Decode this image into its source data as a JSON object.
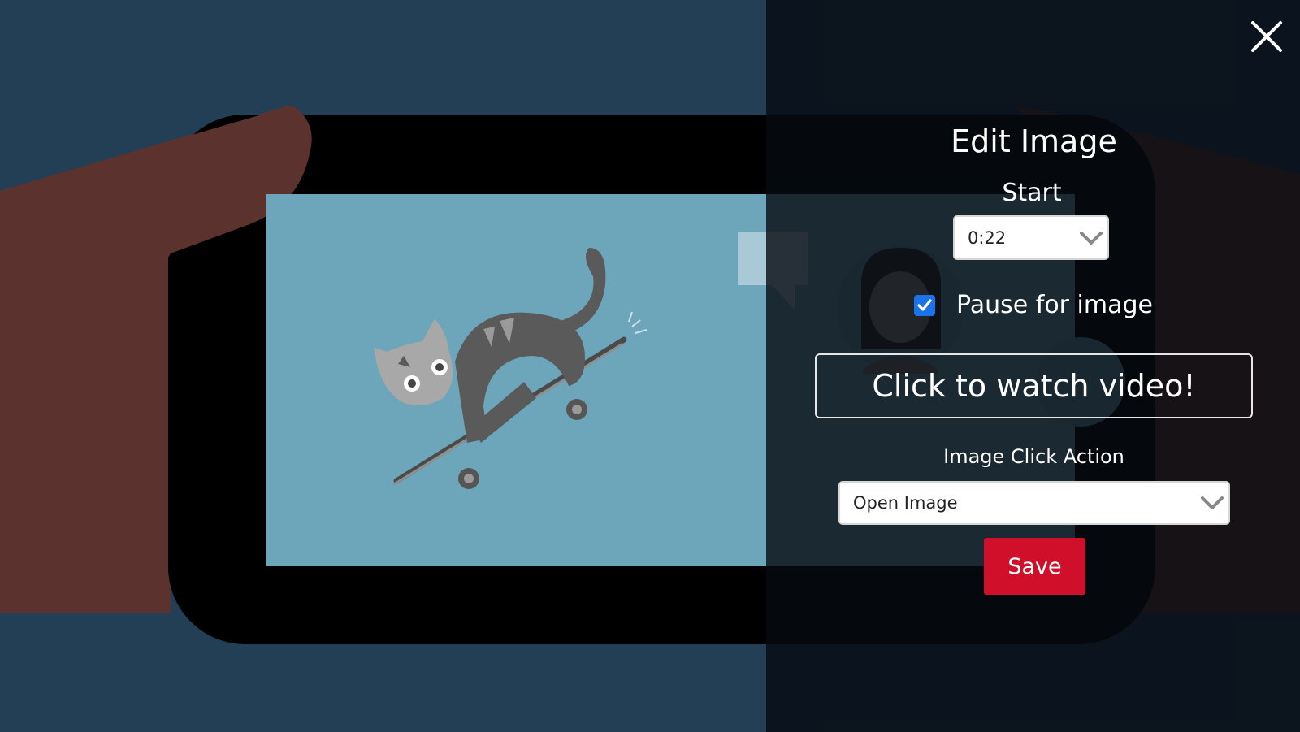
{
  "dialog": {
    "title": "Edit Image",
    "start_label": "Start",
    "start_value": "0:22",
    "pause_label": "Pause for image",
    "pause_checked": true,
    "caption_value": "Click to watch video!",
    "click_action_label": "Image Click Action",
    "click_action_value": "Open Image",
    "save_label": "Save"
  },
  "colors": {
    "background": "#223f55",
    "screen": "#6da6bb",
    "hand": "#5c322f",
    "accent_button": "#d0102a",
    "checkbox": "#1a73e8"
  },
  "icons": {
    "close": "close-icon",
    "chevron": "chevron-down-icon",
    "check": "check-icon"
  }
}
